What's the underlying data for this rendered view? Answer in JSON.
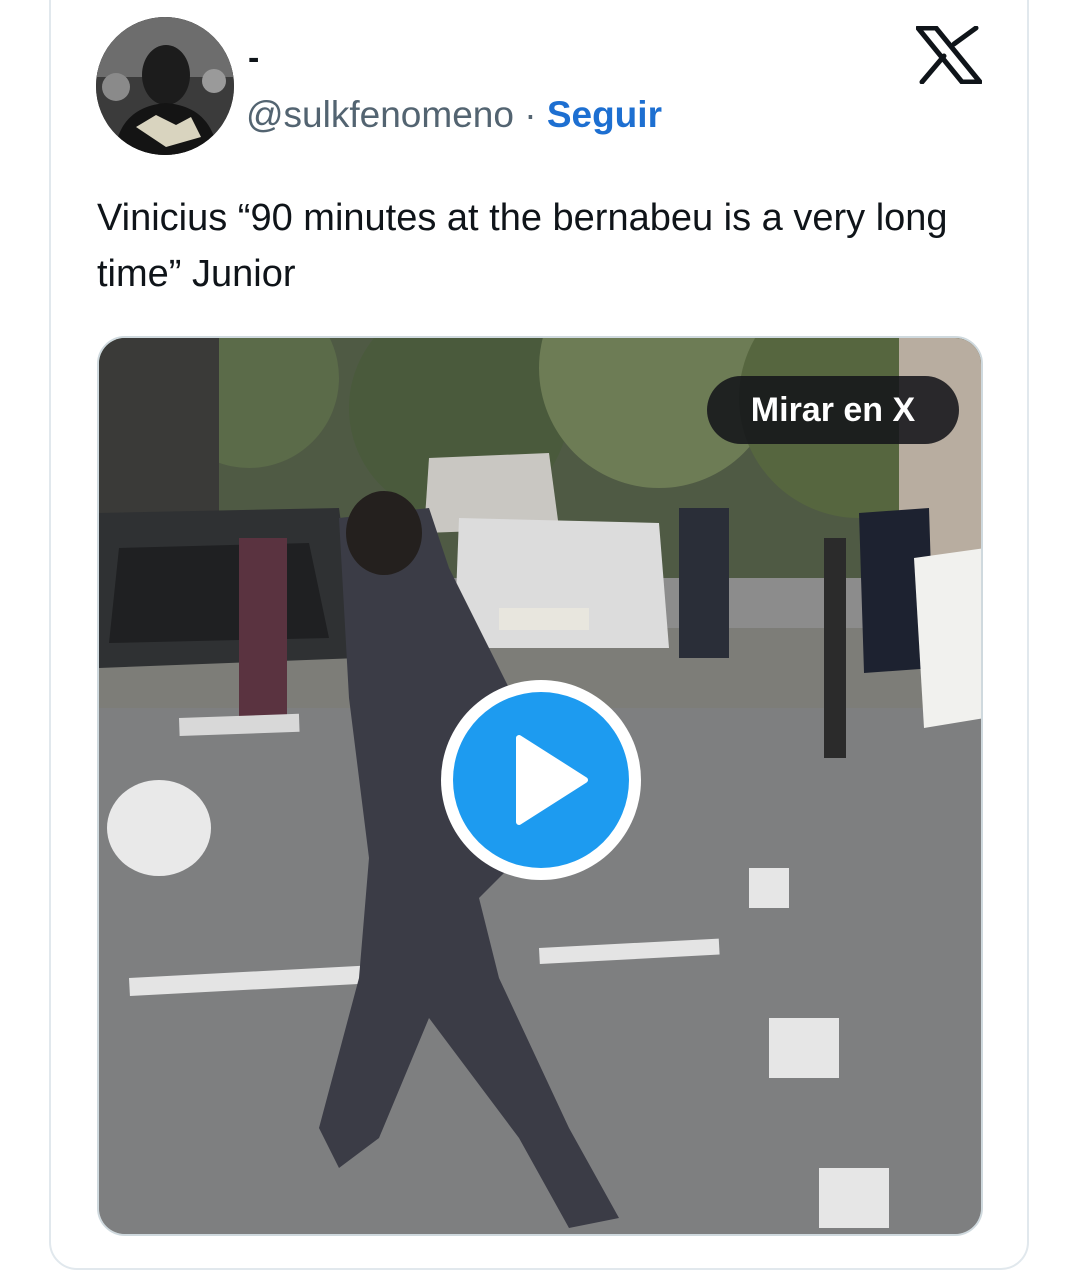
{
  "tweet": {
    "display_name": "-",
    "handle": "@sulkfenomeno",
    "separator": "·",
    "follow_label": "Seguir",
    "text": "Vinicius “90 minutes at the bernabeu is a very long time” Junior"
  },
  "media": {
    "watch_label": "Mirar en X",
    "play_color": "#1d9bf0"
  },
  "colors": {
    "accent": "#1d6fd1",
    "text": "#0f1419",
    "muted": "#536471"
  },
  "icons": {
    "brand": "x-logo-icon",
    "play": "play-icon"
  }
}
